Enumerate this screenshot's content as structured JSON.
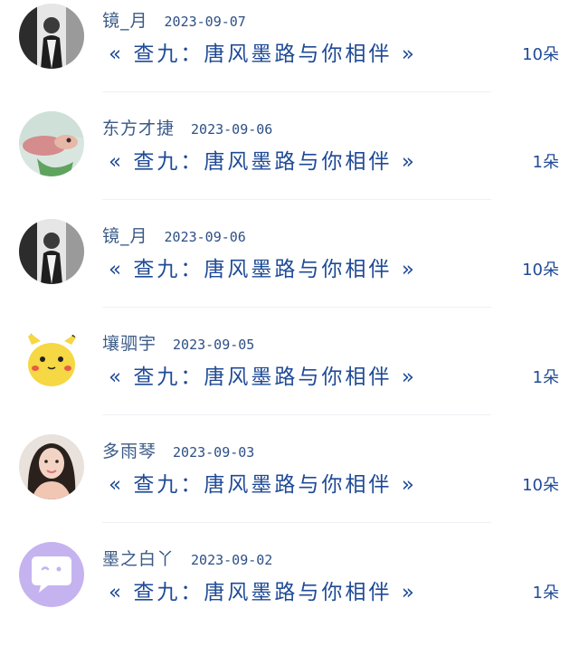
{
  "items": [
    {
      "user": "镜_月",
      "date": "2023-09-07",
      "title": "« 查九：唐风墨路与你相伴 »",
      "count": "10朵",
      "avatar_icon": "person-photo-icon"
    },
    {
      "user": "东方才捷",
      "date": "2023-09-06",
      "title": "« 查九：唐风墨路与你相伴 »",
      "count": "1朵",
      "avatar_icon": "fish-photo-icon"
    },
    {
      "user": "镜_月",
      "date": "2023-09-06",
      "title": "« 查九：唐风墨路与你相伴 »",
      "count": "10朵",
      "avatar_icon": "person-photo-icon"
    },
    {
      "user": "壤驷宇",
      "date": "2023-09-05",
      "title": "« 查九：唐风墨路与你相伴 »",
      "count": "1朵",
      "avatar_icon": "pikachu-icon"
    },
    {
      "user": "多雨琴",
      "date": "2023-09-03",
      "title": "« 查九：唐风墨路与你相伴 »",
      "count": "10朵",
      "avatar_icon": "woman-photo-icon"
    },
    {
      "user": "墨之白丫",
      "date": "2023-09-02",
      "title": "« 查九：唐风墨路与你相伴 »",
      "count": "1朵",
      "avatar_icon": "chat-bubble-icon"
    }
  ],
  "colors": {
    "name": "#3a5a86",
    "title": "#1f4a96",
    "divider": "#eef1f6",
    "default_avatar": "#c5b3f0"
  }
}
